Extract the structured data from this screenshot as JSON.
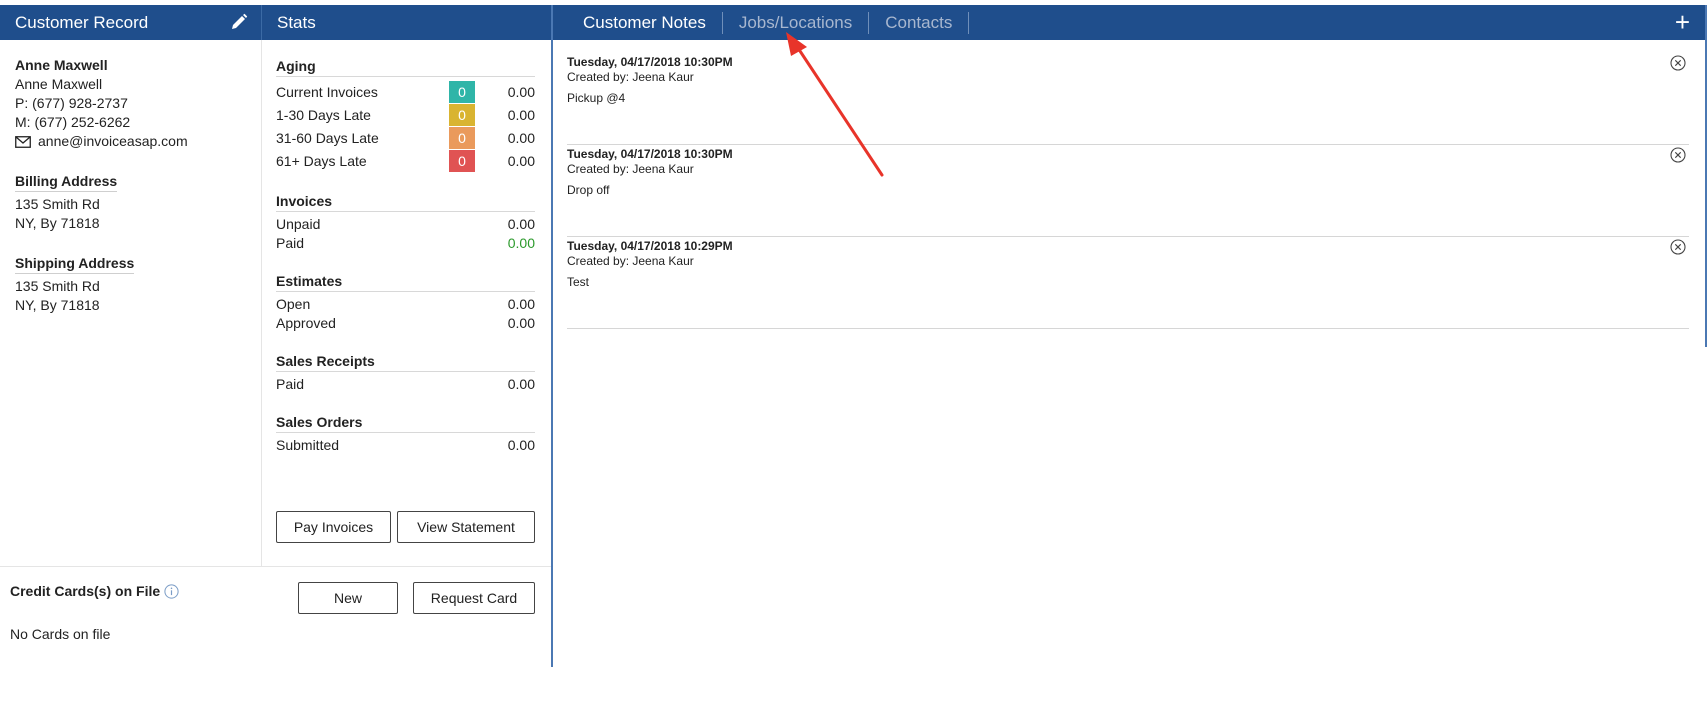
{
  "customer_panel": {
    "title": "Customer Record",
    "name": "Anne Maxwell",
    "contact_name": "Anne Maxwell",
    "phone": "P: (677) 928-2737",
    "mobile": "M: (677) 252-6262",
    "email": "anne@invoiceasap.com",
    "billing": {
      "title": "Billing Address",
      "line1": "135 Smith Rd",
      "line2": "NY, By 71818"
    },
    "shipping": {
      "title": "Shipping Address",
      "line1": "135 Smith Rd",
      "line2": "NY, By 71818"
    }
  },
  "stats": {
    "title": "Stats",
    "aging": {
      "title": "Aging",
      "rows": [
        {
          "label": "Current Invoices",
          "count": "0",
          "amount": "0.00",
          "color": "#2fb5a8"
        },
        {
          "label": "1-30 Days Late",
          "count": "0",
          "amount": "0.00",
          "color": "#d9b431"
        },
        {
          "label": "31-60 Days Late",
          "count": "0",
          "amount": "0.00",
          "color": "#ea9a5c"
        },
        {
          "label": "61+ Days Late",
          "count": "0",
          "amount": "0.00",
          "color": "#e05353"
        }
      ]
    },
    "invoices": {
      "title": "Invoices",
      "unpaid_label": "Unpaid",
      "unpaid": "0.00",
      "paid_label": "Paid",
      "paid": "0.00"
    },
    "estimates": {
      "title": "Estimates",
      "open_label": "Open",
      "open": "0.00",
      "approved_label": "Approved",
      "approved": "0.00"
    },
    "sales_receipts": {
      "title": "Sales Receipts",
      "paid_label": "Paid",
      "paid": "0.00"
    },
    "sales_orders": {
      "title": "Sales Orders",
      "submitted_label": "Submitted",
      "submitted": "0.00"
    },
    "pay_invoices_label": "Pay Invoices",
    "view_statement_label": "View Statement"
  },
  "credit_cards": {
    "title": "Credit Cards(s) on File",
    "empty": "No Cards on file",
    "new_label": "New",
    "request_label": "Request Card"
  },
  "tabs": [
    {
      "label": "Customer Notes",
      "active": true
    },
    {
      "label": "Jobs/Locations",
      "active": false
    },
    {
      "label": "Contacts",
      "active": false
    }
  ],
  "add_icon": "+",
  "notes": [
    {
      "timestamp": "Tuesday, 04/17/2018 10:30PM",
      "created_by": "Created by: Jeena Kaur",
      "text": "Pickup @4"
    },
    {
      "timestamp": "Tuesday, 04/17/2018 10:30PM",
      "created_by": "Created by: Jeena Kaur",
      "text": "Drop off"
    },
    {
      "timestamp": "Tuesday, 04/17/2018 10:29PM",
      "created_by": "Created by: Jeena Kaur",
      "text": "Test"
    }
  ],
  "colors": {
    "header_blue": "#1f4e8c",
    "annotation_arrow": "#e8342a"
  },
  "icons": {
    "edit": "pencil-icon",
    "email": "envelope-icon",
    "info": "info-icon",
    "delete": "close-circle-icon",
    "add": "plus-icon"
  }
}
